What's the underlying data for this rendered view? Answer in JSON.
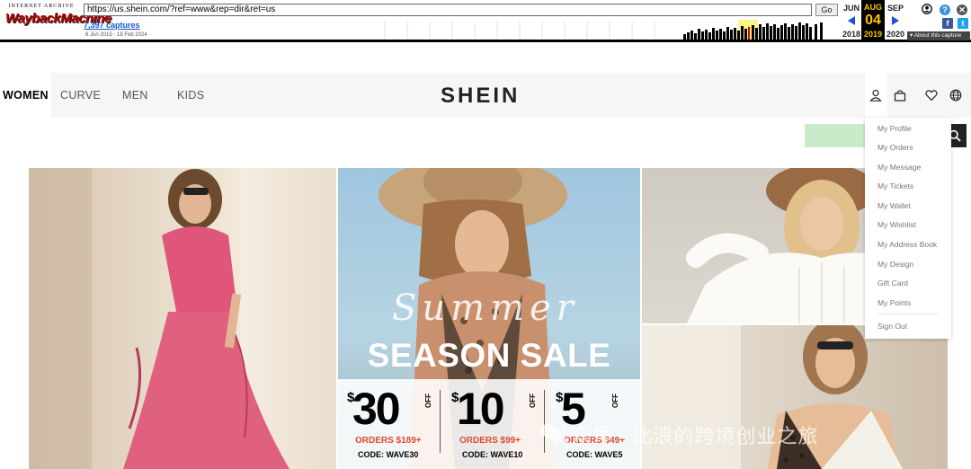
{
  "wayback": {
    "logo_top": "INTERNET ARCHIVE",
    "logo_main": "WaybackMachine",
    "url": "https://us.shein.com/?ref=www&rep=dir&ret=us",
    "go_label": "Go",
    "captures": "7,397 captures",
    "date_range": "6 Jun 2015 - 16 Feb 2024",
    "prev_month": "JUN",
    "cur_month": "AUG",
    "next_month": "SEP",
    "cur_day": "04",
    "prev_year": "2018",
    "cur_year": "2019",
    "next_year": "2020",
    "about_label": "About this capture",
    "help_glyph": "?",
    "close_glyph": "✕",
    "fb_glyph": "f",
    "tw_glyph": "t",
    "accent_color": "#1a4fe0",
    "current_bg": "#000000",
    "current_fg": "#ffc700"
  },
  "nav": {
    "women": "WOMEN",
    "curve": "CURVE",
    "men": "MEN",
    "kids": "KIDS",
    "logo": "SHEIN"
  },
  "icons": [
    "user-icon",
    "bag-icon",
    "heart-icon",
    "globe-icon",
    "search-icon"
  ],
  "user_menu": {
    "items": [
      "My Profile",
      "My Orders",
      "My Message",
      "My Tickets",
      "My Wallet",
      "My Wishlist",
      "My Address Book",
      "My Design",
      "Gift Card",
      "My Points"
    ],
    "sign_out": "Sign Out"
  },
  "banner": {
    "script": "Summer",
    "title": "SEASON SALE",
    "deals": [
      {
        "currency": "$",
        "amount": "30",
        "off": "OFF",
        "orders": "ORDERS $189+",
        "code": "CODE: WAVE30"
      },
      {
        "currency": "$",
        "amount": "10",
        "off": "OFF",
        "orders": "ORDERS $99+",
        "code": "CODE: WAVE10"
      },
      {
        "currency": "$",
        "amount": "5",
        "off": "OFF",
        "orders": "ORDERS $49+",
        "code": "CODE: WAVE5"
      }
    ],
    "sale_accent": "#e04a2e"
  },
  "watermark": "公众号 · 比浪的跨境创业之旅"
}
